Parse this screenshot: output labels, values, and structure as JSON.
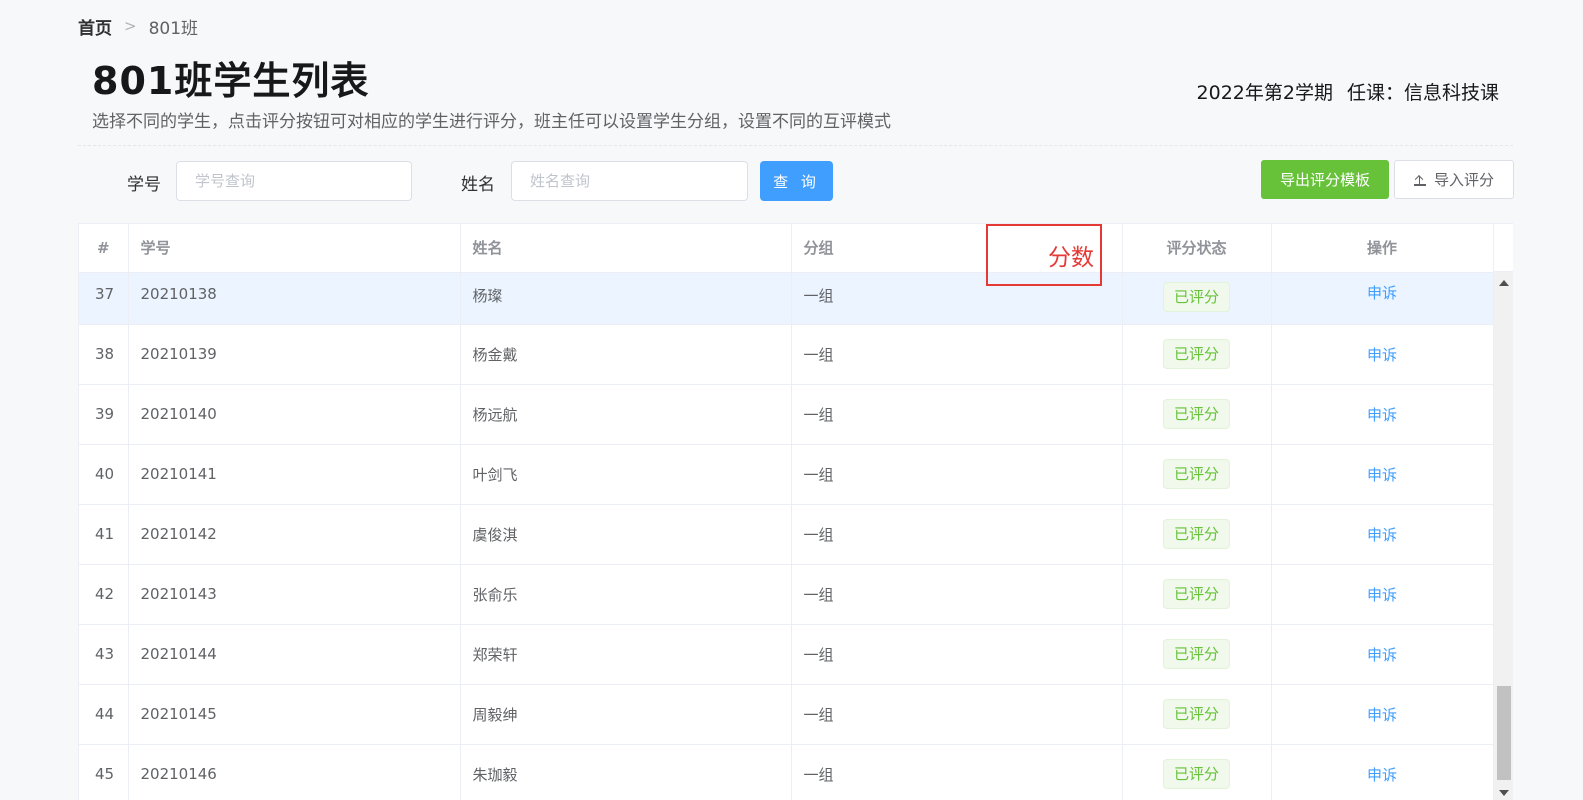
{
  "breadcrumb": {
    "home": "首页",
    "separator": ">",
    "current": "801班"
  },
  "page": {
    "title": "801班学生列表",
    "description": "选择不同的学生，点击评分按钮可对相应的学生进行评分，班主任可以设置学生分组，设置不同的互评模式",
    "term": "2022年第2学期",
    "course": "任课：信息科技课"
  },
  "filters": {
    "student_id_label": "学号",
    "student_id_placeholder": "学号查询",
    "name_label": "姓名",
    "name_placeholder": "姓名查询",
    "query_button": "查 询"
  },
  "actions": {
    "export_label": "导出评分模板",
    "import_label": "导入评分",
    "import_icon": "upload-icon"
  },
  "table": {
    "columns": {
      "index": "#",
      "student_id": "学号",
      "name": "姓名",
      "group": "分组",
      "score": "分数",
      "status": "评分状态",
      "operation": "操作"
    },
    "rows": [
      {
        "index": "37",
        "student_id": "20210138",
        "name": "杨璨",
        "group": "一组",
        "status": "已评分",
        "action": "申诉"
      },
      {
        "index": "38",
        "student_id": "20210139",
        "name": "杨金戴",
        "group": "一组",
        "status": "已评分",
        "action": "申诉"
      },
      {
        "index": "39",
        "student_id": "20210140",
        "name": "杨远航",
        "group": "一组",
        "status": "已评分",
        "action": "申诉"
      },
      {
        "index": "40",
        "student_id": "20210141",
        "name": "叶剑飞",
        "group": "一组",
        "status": "已评分",
        "action": "申诉"
      },
      {
        "index": "41",
        "student_id": "20210142",
        "name": "虞俊淇",
        "group": "一组",
        "status": "已评分",
        "action": "申诉"
      },
      {
        "index": "42",
        "student_id": "20210143",
        "name": "张俞乐",
        "group": "一组",
        "status": "已评分",
        "action": "申诉"
      },
      {
        "index": "43",
        "student_id": "20210144",
        "name": "郑荣轩",
        "group": "一组",
        "status": "已评分",
        "action": "申诉"
      },
      {
        "index": "44",
        "student_id": "20210145",
        "name": "周毅绅",
        "group": "一组",
        "status": "已评分",
        "action": "申诉"
      },
      {
        "index": "45",
        "student_id": "20210146",
        "name": "朱珈毅",
        "group": "一组",
        "status": "已评分",
        "action": "申诉"
      }
    ]
  },
  "colors": {
    "primary": "#409eff",
    "success": "#67c23a",
    "highlight_box": "#e53935"
  }
}
